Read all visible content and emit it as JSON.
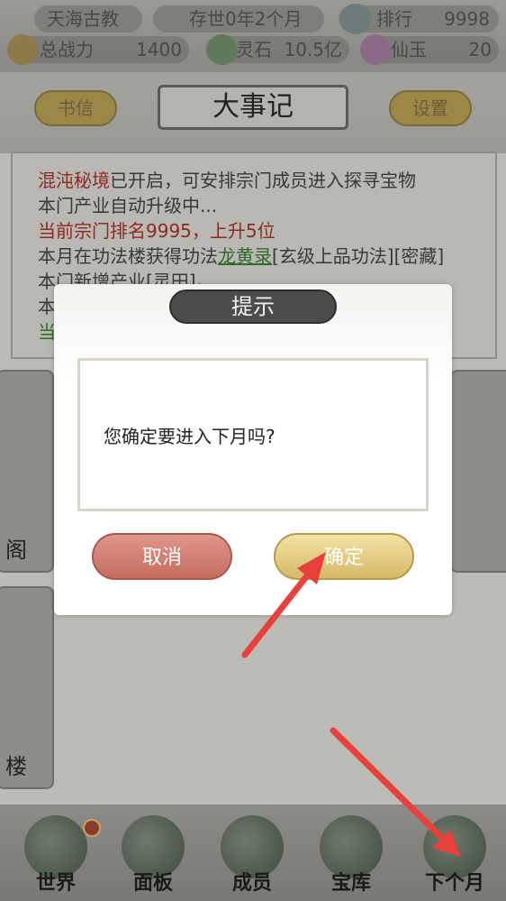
{
  "topbar": {
    "sect_name": "天海古教",
    "age": "存世0年2个月",
    "rank_label": "排行",
    "rank_value": "9998",
    "power_label": "总战力",
    "power_value": "1400",
    "stone_label": "灵石",
    "stone_value": "10.5亿",
    "jade_label": "仙玉",
    "jade_value": "20"
  },
  "header": {
    "letters_label": "书信",
    "title": "大事记",
    "settings_label": "设置"
  },
  "log": {
    "line1_red": "混沌秘境",
    "line1_rest": "已开启，可安排宗门成员进入探寻宝物",
    "line2": "本门产业自动升级中...",
    "line3": "当前宗门排名9995，上升5位",
    "line4_pre": "本月在功法楼获得功法",
    "line4_link": "龙黄录",
    "line4_post": "[玄级上品功法][密藏]",
    "line5": "本门新增产业[灵田]。",
    "line6": "本",
    "line7": "当"
  },
  "side_cards": {
    "left1_label": "阁",
    "left2_label": "楼"
  },
  "dialog": {
    "title": "提示",
    "message": "您确定要进入下月吗?",
    "cancel_label": "取消",
    "confirm_label": "确定"
  },
  "bottom_nav": {
    "items": [
      {
        "label": "世界"
      },
      {
        "label": "面板"
      },
      {
        "label": "成员"
      },
      {
        "label": "宝库"
      },
      {
        "label": "下个月"
      }
    ]
  },
  "colors": {
    "annotation_arrow": "#e8403a"
  }
}
